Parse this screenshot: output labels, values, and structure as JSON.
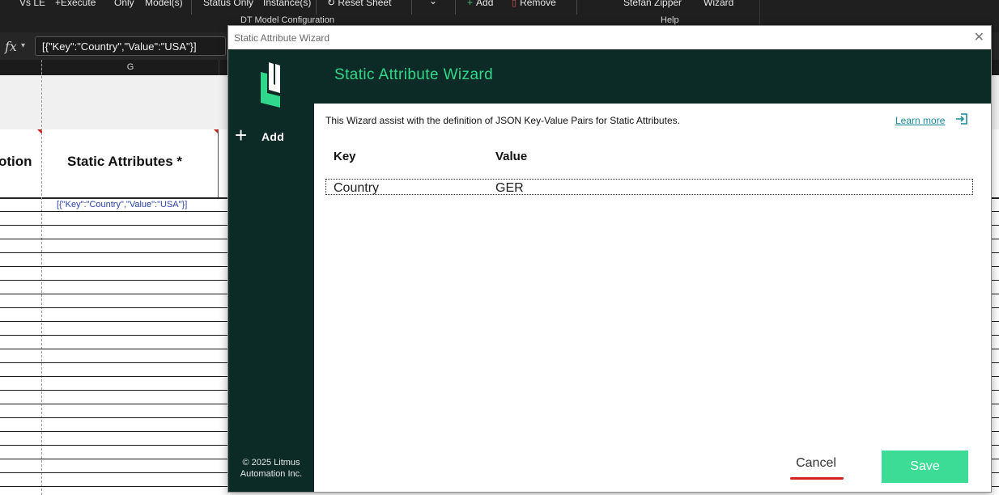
{
  "ribbon": {
    "items": [
      "Vs LE",
      "+Execute",
      "Only",
      "Model(s)",
      "Status Only",
      "Instance(s)",
      "Reset Sheet",
      "Add",
      "Remove",
      "Stefan Zipper",
      "Wizard"
    ],
    "group_labels": [
      "DT Model Configuration",
      "Help"
    ]
  },
  "formula_bar": {
    "fx": "fx",
    "value": "[{\"Key\":\"Country\",\"Value\":\"USA\"}]"
  },
  "sheet": {
    "column_letter": "G",
    "headers": [
      "otion",
      "Static Attributes *"
    ],
    "cell_value": "[{\"Key\":\"Country\",\"Value\":\"USA\"}]"
  },
  "dialog": {
    "window_title": "Static Attribute Wizard",
    "heading": "Static Attribute Wizard",
    "add_label": "Add",
    "intro": "This Wizard assist with the definition of JSON Key-Value Pairs for Static Attributes.",
    "learn_more": "Learn more",
    "columns": {
      "key": "Key",
      "value": "Value"
    },
    "rows": [
      {
        "key": "Country",
        "value": "GER"
      }
    ],
    "cancel": "Cancel",
    "save": "Save",
    "copyright_line1": "© 2025 Litmus",
    "copyright_line2": "Automation Inc.",
    "colors": {
      "brand_dark": "#0c2b27",
      "accent_green": "#2fd88a",
      "save_green": "#3ddc96",
      "cancel_underline": "#d42020"
    }
  }
}
